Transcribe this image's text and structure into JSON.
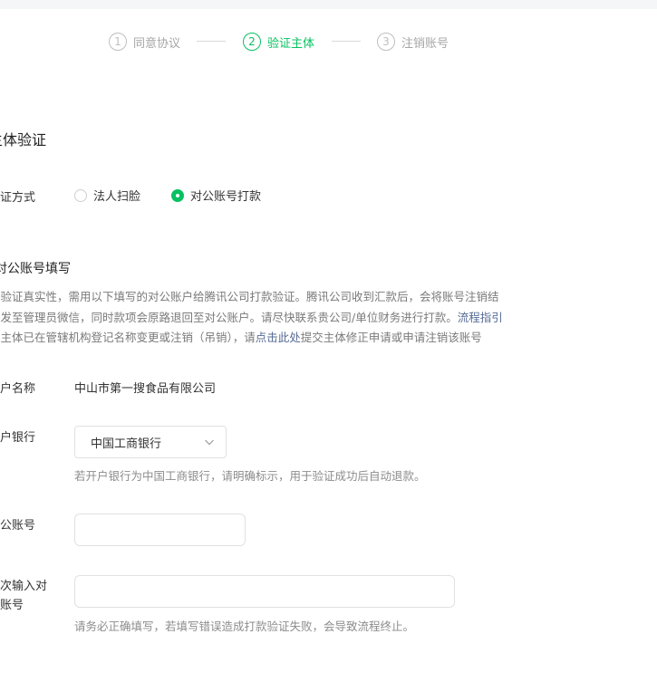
{
  "steps": [
    {
      "num": "1",
      "label": "同意协议"
    },
    {
      "num": "2",
      "label": "验证主体"
    },
    {
      "num": "3",
      "label": "注销账号"
    }
  ],
  "colors": {
    "accent": "#07c160",
    "link": "#576b95"
  },
  "section_title": "主体验证",
  "verify_method": {
    "label": "验证方式",
    "options": [
      "法人扫脸",
      "对公账号打款"
    ],
    "selected": "对公账号打款"
  },
  "account_fill": {
    "title": "对公账号填写",
    "notice_line1": "为验证真实性，需用以下填写的对公账户给腾讯公司打款验证。腾讯公司收到汇款后，会将账号注销结",
    "notice_line2": "果发至管理员微信，同时款项会原路退回至对公账户。请尽快联系贵公司/单位财务进行打款。",
    "notice_link": "流程指引",
    "notice_line3a": "若主体已在管辖机构登记名称变更或注销（吊销），请",
    "notice_link2": "点击此处",
    "notice_line3b": "提交主体修正申请或申请注销该账号"
  },
  "fields": {
    "account_name_label": "开户名称",
    "account_name_value": "中山市第一搜食品有限公司",
    "bank_label": "开户银行",
    "bank_value": "中国工商银行",
    "bank_hint": "若开户银行为中国工商银行，请明确标示，用于验证成功后自动退款。",
    "account_no_label": "对公账号",
    "account_no_value": "",
    "confirm_label_line1": "再次输入对",
    "confirm_label_line2": "公账号",
    "confirm_value": "",
    "confirm_hint": "请务必正确填写，若填写错误造成打款验证失败，会导致流程终止。"
  }
}
